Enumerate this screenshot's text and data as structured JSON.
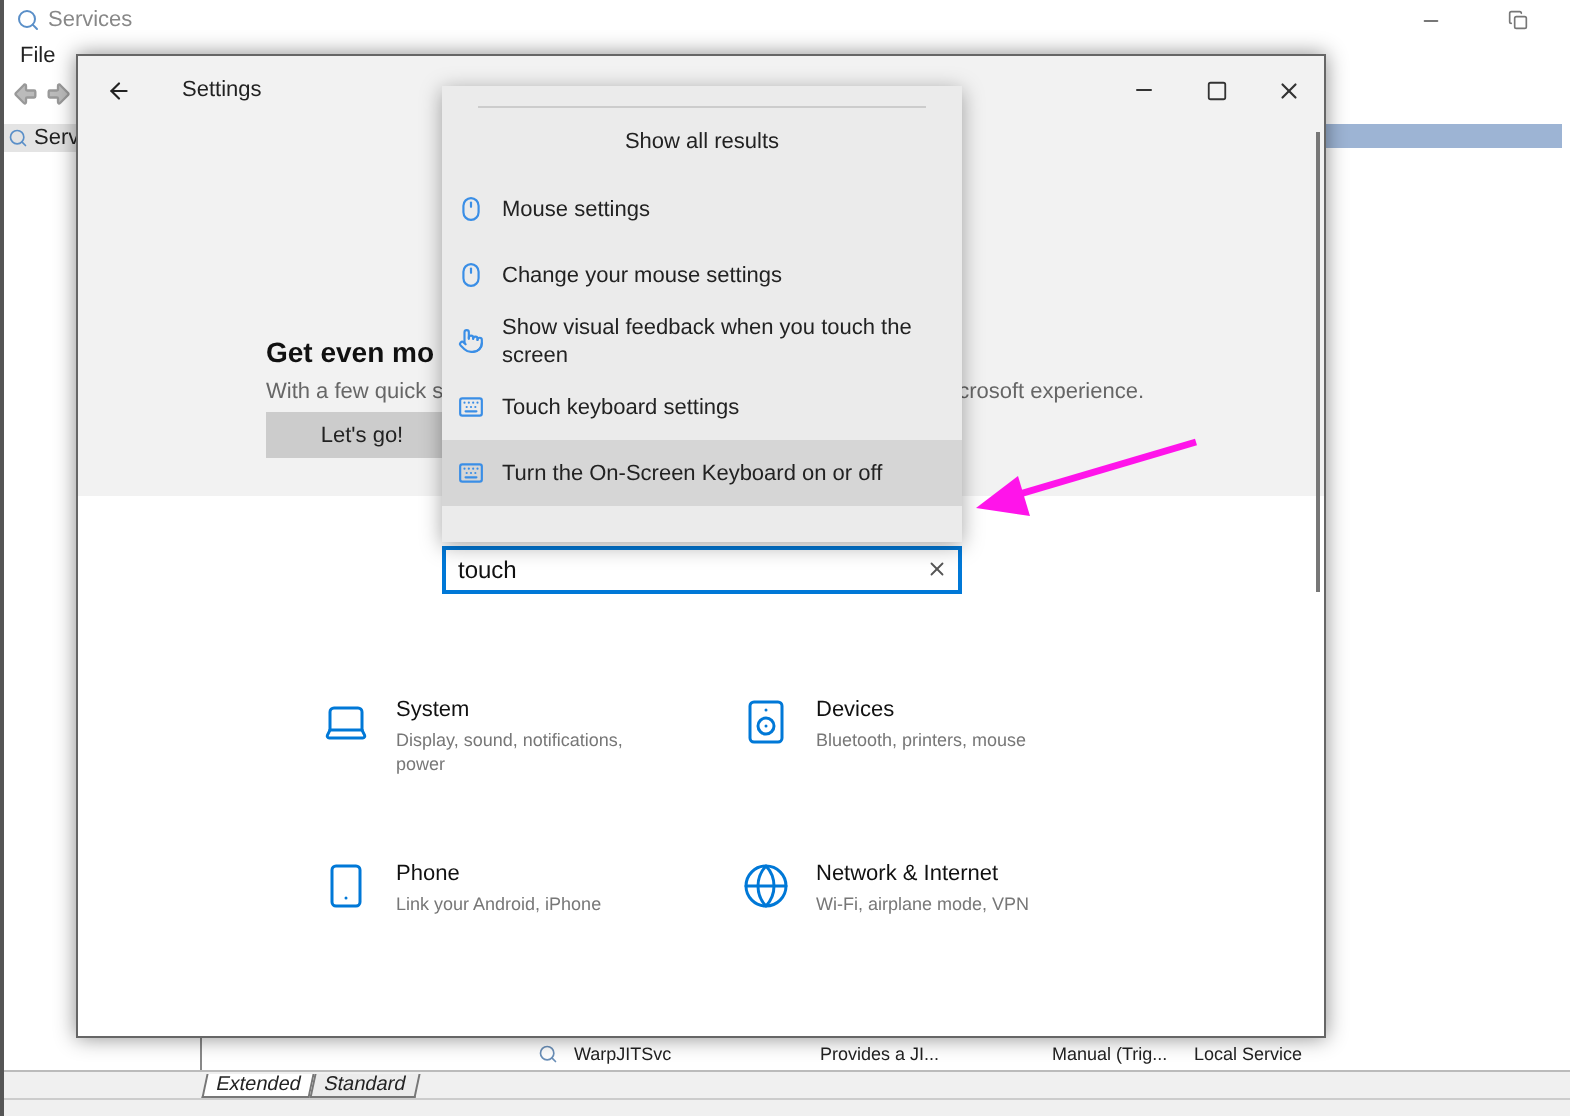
{
  "services_window": {
    "title": "Services",
    "menu": [
      "File"
    ],
    "tree_item": "Serv",
    "rows": [
      {
        "selected": true
      },
      {
        "selected": false,
        "name": "WarpJITSvc",
        "description": "Provides a JI...",
        "startup": "Manual (Trig...",
        "log_on_as": "Local Service"
      }
    ],
    "tabs": [
      {
        "label": "Extended",
        "selected": true
      },
      {
        "label": "Standard",
        "selected": false
      }
    ]
  },
  "settings_window": {
    "title": "Settings",
    "banner": {
      "heading": "Get even mo",
      "text_left": "With a few quick s",
      "text_right": "crosoft experience.",
      "button": "Let's go!"
    },
    "search": {
      "value": "touch"
    },
    "categories": [
      {
        "name": "System",
        "description": "Display, sound, notifications, power",
        "kind": "laptop"
      },
      {
        "name": "Devices",
        "description": "Bluetooth, printers, mouse",
        "kind": "devices"
      },
      {
        "name": "Phone",
        "description": "Link your Android, iPhone",
        "kind": "phone"
      },
      {
        "name": "Network & Internet",
        "description": "Wi-Fi, airplane mode, VPN",
        "kind": "globe"
      }
    ]
  },
  "search_results": {
    "header": "Show all results",
    "results": [
      {
        "label": "Mouse settings",
        "kind": "mouse",
        "selected": false
      },
      {
        "label": "Change your mouse settings",
        "kind": "mouse",
        "selected": false
      },
      {
        "label": "Show visual feedback when you touch the screen",
        "kind": "hand",
        "selected": false
      },
      {
        "label": "Touch keyboard settings",
        "kind": "keyboard",
        "selected": false
      },
      {
        "label": "Turn the On-Screen Keyboard on or off",
        "kind": "keyboard",
        "selected": true
      }
    ]
  }
}
